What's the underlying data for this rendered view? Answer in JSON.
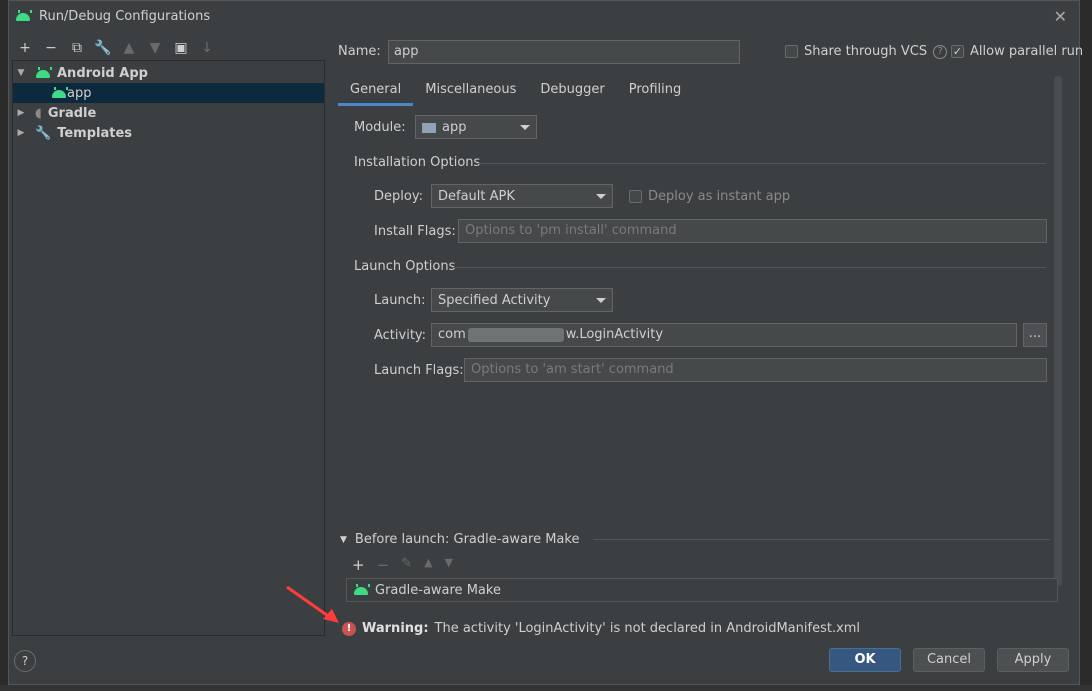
{
  "window": {
    "title": "Run/Debug Configurations"
  },
  "toolbar": {
    "add": "+",
    "remove": "−",
    "copy": "⧉",
    "edit": "🔧",
    "up": "▲",
    "down": "▼",
    "folder": "▣",
    "sort": "↓"
  },
  "tree": {
    "android_app": "Android App",
    "app": "app",
    "gradle": "Gradle",
    "templates": "Templates"
  },
  "config": {
    "name_label": "Name:",
    "name_value": "app",
    "share_vcs": "Share through VCS",
    "allow_parallel": "Allow parallel run"
  },
  "tabs": [
    "General",
    "Miscellaneous",
    "Debugger",
    "Profiling"
  ],
  "general": {
    "module_label": "Module:",
    "module_value": "app",
    "installation_title": "Installation Options",
    "deploy_label": "Deploy:",
    "deploy_value": "Default APK",
    "deploy_instant": "Deploy as instant app",
    "install_flags_label": "Install Flags:",
    "install_flags_placeholder": "Options to 'pm install' command",
    "launch_title": "Launch Options",
    "launch_label": "Launch:",
    "launch_value": "Specified Activity",
    "activity_label": "Activity:",
    "activity_prefix": "com",
    "activity_suffix": "w.LoginActivity",
    "activity_browse": "...",
    "launch_flags_label": "Launch Flags:",
    "launch_flags_placeholder": "Options to 'am start' command"
  },
  "before_launch": {
    "title": "Before launch: Gradle-aware Make",
    "item": "Gradle-aware Make"
  },
  "warning": {
    "prefix": "Warning:",
    "message": "The activity 'LoginActivity' is not declared in AndroidManifest.xml"
  },
  "buttons": {
    "help": "?",
    "ok": "OK",
    "cancel": "Cancel",
    "apply": "Apply"
  },
  "colors": {
    "accent": "#4a88c7",
    "ok_button": "#365880",
    "error": "#c75450",
    "android": "#3ddc84",
    "annotation_arrow": "#ff3b3b"
  }
}
